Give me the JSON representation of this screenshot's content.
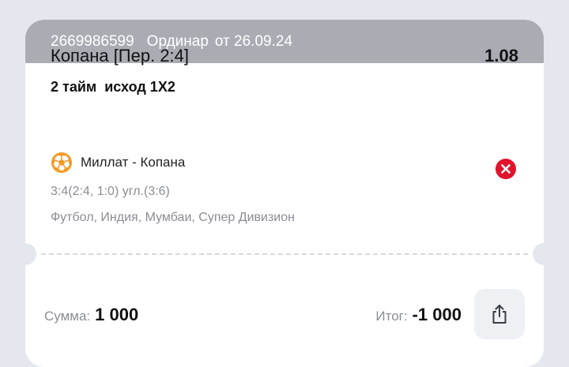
{
  "header": {
    "bet_id": "2669986599",
    "bet_type": "Ординар",
    "date": "от 26.09.24"
  },
  "bet": {
    "market": "Копана [Пер. 2:4]",
    "odds": "1.08",
    "outcome": "2 тайм  исход 1X2",
    "event": "Миллат - Копана",
    "score": "3:4(2:4, 1:0) угл.(3:6)",
    "league": "Футбол, Индия, Мумбаи, Супер Дивизион",
    "sport_icon": "soccer-ball-icon",
    "status_icon": "lost-x-icon"
  },
  "footer": {
    "stake_label": "Сумма:",
    "stake_value": "1 000",
    "result_label": "Итог:",
    "result_value": "-1 000",
    "share_icon": "share-icon"
  },
  "colors": {
    "background": "#e4e7ee",
    "header_bg": "#a9acb3",
    "lost_red": "#e0142a",
    "ball_orange": "#f39a25",
    "muted_text": "#8a8d94"
  }
}
